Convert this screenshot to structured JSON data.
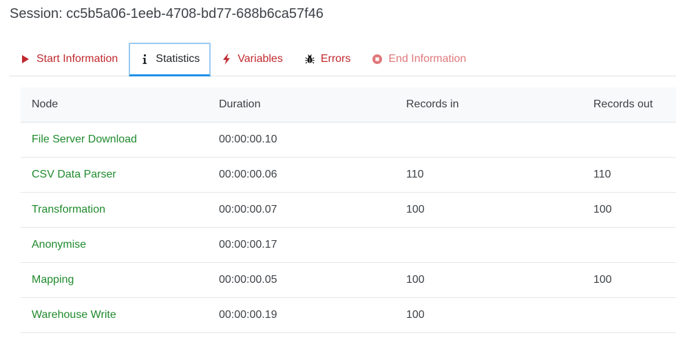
{
  "session": {
    "title": "Session: cc5b5a06-1eeb-4708-bd77-688b6ca57f46"
  },
  "tabs": [
    {
      "label": "Start Information",
      "icon": "play-icon",
      "state": "normal"
    },
    {
      "label": "Statistics",
      "icon": "info-icon",
      "state": "active"
    },
    {
      "label": "Variables",
      "icon": "lightning-icon",
      "state": "normal"
    },
    {
      "label": "Errors",
      "icon": "bug-icon",
      "state": "normal"
    },
    {
      "label": "End Information",
      "icon": "stop-circle-icon",
      "state": "disabled"
    }
  ],
  "table": {
    "headers": [
      "Node",
      "Duration",
      "Records in",
      "Records out"
    ],
    "rows": [
      {
        "node": "File Server Download",
        "duration": "00:00:00.10",
        "records_in": "",
        "records_out": ""
      },
      {
        "node": "CSV Data Parser",
        "duration": "00:00:00.06",
        "records_in": "110",
        "records_out": "110"
      },
      {
        "node": "Transformation",
        "duration": "00:00:00.07",
        "records_in": "100",
        "records_out": "100"
      },
      {
        "node": "Anonymise",
        "duration": "00:00:00.17",
        "records_in": "",
        "records_out": ""
      },
      {
        "node": "Mapping",
        "duration": "00:00:00.05",
        "records_in": "100",
        "records_out": "100"
      },
      {
        "node": "Warehouse Write",
        "duration": "00:00:00.19",
        "records_in": "100",
        "records_out": ""
      }
    ]
  },
  "colors": {
    "tab_text": "#c0282d",
    "tab_disabled": "#e0787b",
    "active_border": "#1e90e6",
    "node_link": "#1f8a2c",
    "header_bg": "#f8f9fa"
  }
}
